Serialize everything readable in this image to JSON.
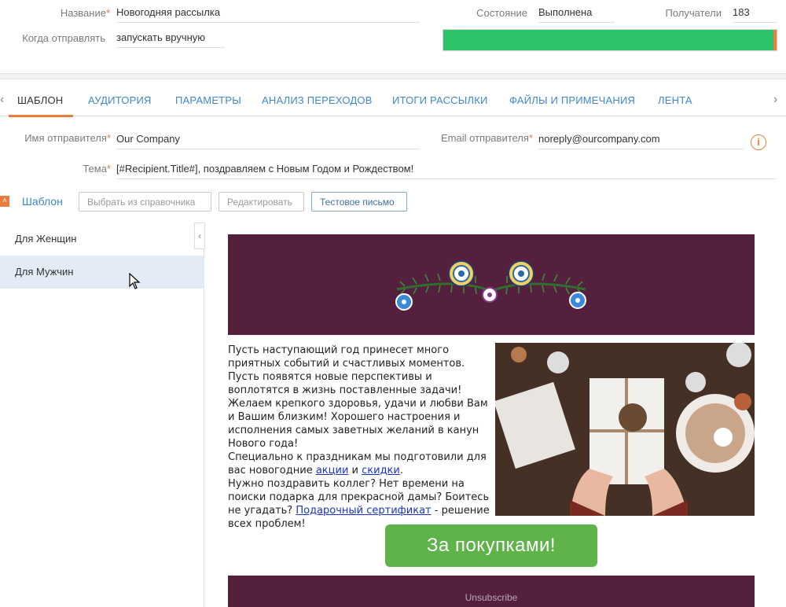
{
  "header": {
    "name_label": "Название",
    "name_value": "Новогодняя рассылка",
    "when_label": "Когда отправлять",
    "when_value": "запускать вручную",
    "state_label": "Состояние",
    "state_value": "Выполнена",
    "recipients_label": "Получатели",
    "recipients_value": "183",
    "progress": 0.99
  },
  "tabs": [
    {
      "label": "ШАБЛОН"
    },
    {
      "label": "АУДИТОРИЯ"
    },
    {
      "label": "ПАРАМЕТРЫ"
    },
    {
      "label": "АНАЛИЗ ПЕРЕХОДОВ"
    },
    {
      "label": "ИТОГИ РАССЫЛКИ"
    },
    {
      "label": "ФАЙЛЫ И ПРИМЕЧАНИЯ"
    },
    {
      "label": "ЛЕНТА"
    }
  ],
  "form": {
    "sender_name_label": "Имя отправителя",
    "sender_name_value": "Our Company",
    "sender_email_label": "Email отправителя",
    "sender_email_value": "noreply@ourcompany.com",
    "subject_label": "Тема",
    "subject_value": "[#Recipient.Title#], поздравляем с Новым Годом и Рождеством!"
  },
  "template_section": {
    "title": "Шаблон",
    "btn_pick": "Выбрать из справочника",
    "btn_edit": "Редактировать",
    "btn_test": "Тестовое письмо"
  },
  "templates": [
    {
      "label": "Для Женщин"
    },
    {
      "label": "Для Мужчин"
    }
  ],
  "email": {
    "p1": "Пусть наступающий год принесет много приятных событий и счастливых моментов. Пусть появятся новые перспективы и воплотятся в жизнь поставленные задачи! Желаем крепкого здоровья, удачи и любви Вам и Вашим близким! Хорошего настроения и исполнения самых заветных желаний в канун Нового года!",
    "p2_a": "Специально к праздникам мы подготовили для вас новогодние ",
    "link_actions": "акции",
    "and": " и ",
    "link_discounts": "скидки",
    "dot": ".",
    "p3_a": "Нужно поздравить коллег? Нет времени на поиски подарка для прекрасной дамы? Боитесь не угадать? ",
    "link_cert": "Подарочный сертификат",
    "p3_b": " - решение всех проблем!",
    "shop_button": "За покупками!",
    "unsubscribe": "Unsubscribe"
  },
  "colors": {
    "accent": "#e87d3e",
    "link": "#3f87c9",
    "progress": "#2cc36b",
    "banner": "#55203e",
    "button": "#5fb34a"
  }
}
